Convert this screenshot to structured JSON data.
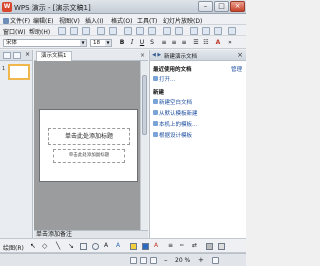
{
  "window": {
    "title": "WPS 演示 - [演示文稿1]",
    "app_icon_letter": "W"
  },
  "menubar": {
    "items": [
      "文件(F)",
      "编辑(E)",
      "视图(V)",
      "插入(I)",
      "格式(O)",
      "工具(T)",
      "幻灯片放映(D)"
    ],
    "row2_items": [
      "窗口(W)",
      "帮助(H)"
    ]
  },
  "toolbar": {
    "font_name": "宋体",
    "font_size": "18"
  },
  "doc": {
    "tab_label": "演示文稿1"
  },
  "slide": {
    "thumb_number": "1",
    "title_placeholder": "单击此处添加标题",
    "subtitle_placeholder": "单击此处添加副标题"
  },
  "notes": {
    "placeholder": "单击添加备注"
  },
  "taskpane": {
    "title": "新建演示文档",
    "recent_section": "最近使用的文档",
    "manage_link": "管理",
    "open_link": "打开...",
    "new_section": "新建",
    "links": [
      "新建空白文档",
      "从默认模板新建",
      "本机上的模板...",
      "根据设计模板"
    ]
  },
  "drawbar": {
    "label": "绘图(R)"
  },
  "status": {
    "zoom": "20 %"
  }
}
